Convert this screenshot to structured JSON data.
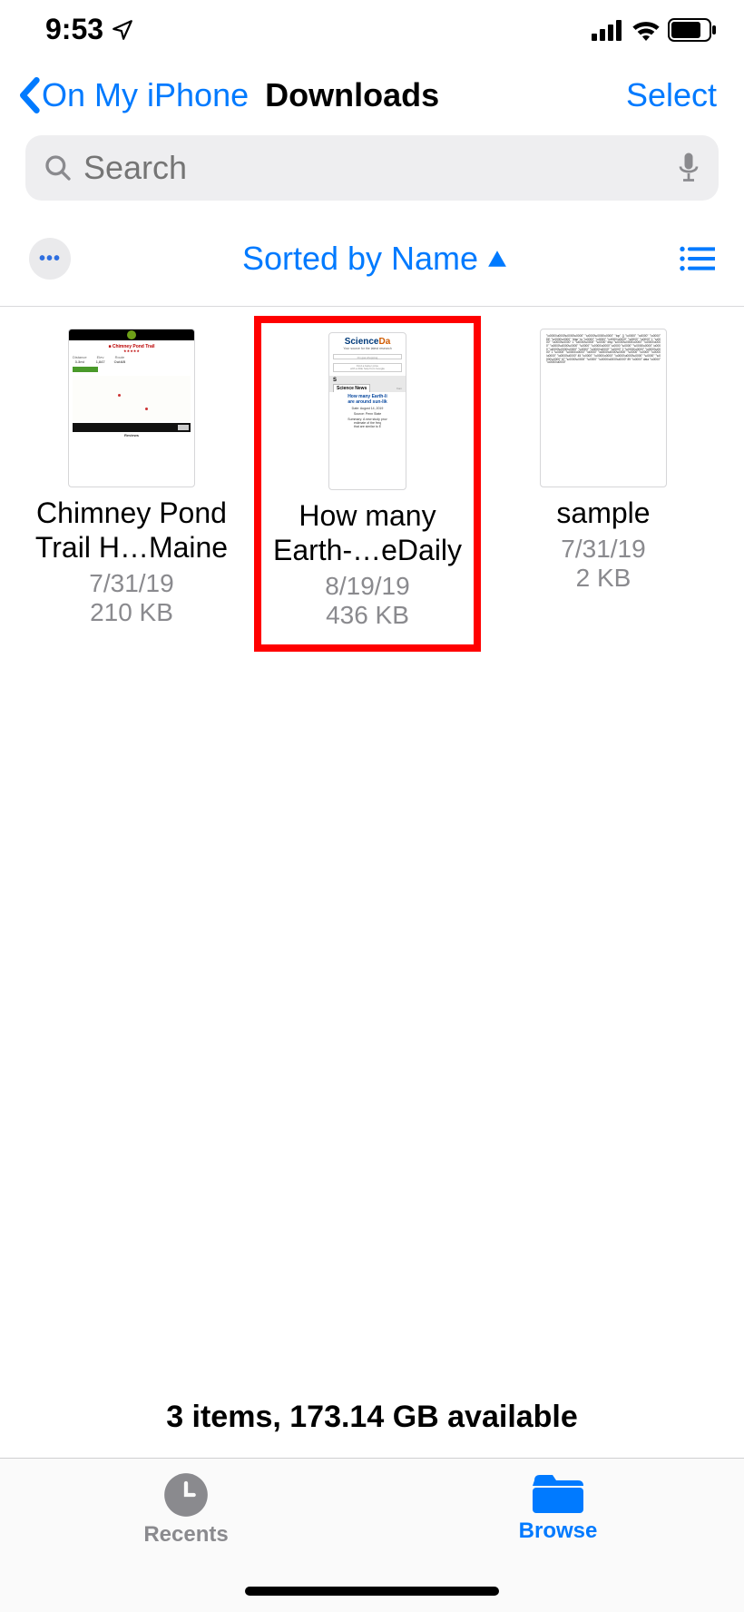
{
  "status": {
    "time": "9:53"
  },
  "nav": {
    "back_label": "On My iPhone",
    "title": "Downloads",
    "select_label": "Select"
  },
  "search": {
    "placeholder": "Search"
  },
  "sort": {
    "label": "Sorted by Name"
  },
  "files": [
    {
      "name": "Chimney Pond Trail H…Maine",
      "date": "7/31/19",
      "size": "210 KB",
      "highlighted": false
    },
    {
      "name": "How many Earth-…eDaily",
      "date": "8/19/19",
      "size": "436 KB",
      "highlighted": true
    },
    {
      "name": "sample",
      "date": "7/31/19",
      "size": "2 KB",
      "highlighted": false
    }
  ],
  "summary": "3 items, 173.14 GB available",
  "tabs": {
    "recents": "Recents",
    "browse": "Browse"
  },
  "thumb2": {
    "logo_a": "Science",
    "logo_b": "Da",
    "tagline": "Your source for the latest research",
    "ad1": "On gas shopping",
    "ad2a": "Find a better price",
    "ad2b": "with a little help from Google",
    "s": "S",
    "tab": "Science News",
    "from": "from",
    "headline1": "How many Earth-li",
    "headline2": "are around sun-lik",
    "date_k": "Date:",
    "date_v": "August 14, 2019",
    "src_k": "Source:",
    "src_v": "Penn State",
    "sum_k": "Summary:",
    "sum_v1": "A new study prov",
    "sum_v2": "estimate of the freq",
    "sum_v3": "that are similar to E"
  }
}
